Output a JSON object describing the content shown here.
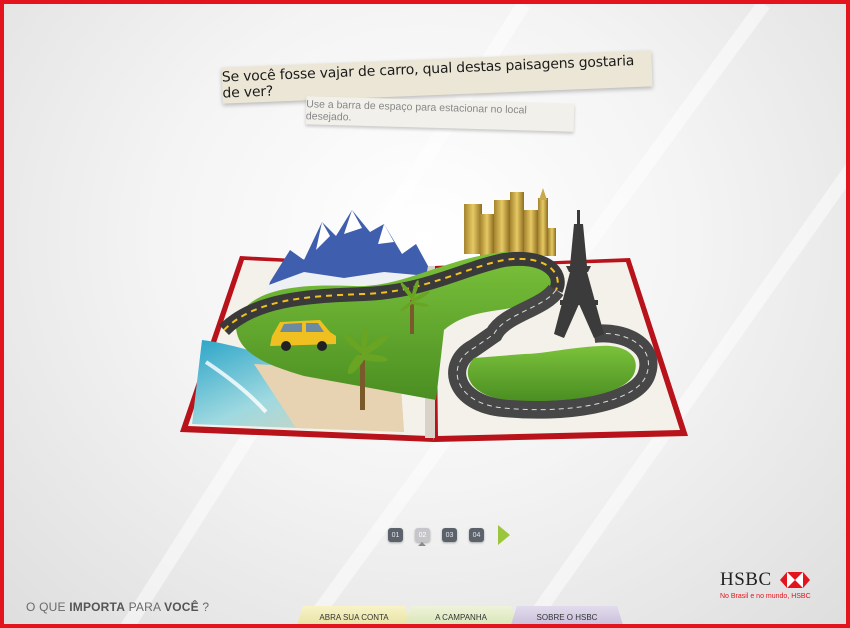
{
  "header": {
    "question": "Se você fosse vajar de carro, qual destas paisagens gostaria de ver?",
    "hint": "Use a barra de espaço para estacionar no local desejado."
  },
  "pager": {
    "pages": [
      "01",
      "02",
      "03",
      "04"
    ],
    "active": "02",
    "next_icon": "next-arrow-icon"
  },
  "footer": {
    "slogan_prefix": "O QUE ",
    "slogan_importa": "IMPORTA",
    "slogan_para": " PARA ",
    "slogan_voce": "VOCÊ",
    "slogan_suffix": " ?",
    "tabs": [
      "ABRA SUA CONTA",
      "A CAMPANHA",
      "SOBRE O HSBC"
    ]
  },
  "brand": {
    "name": "HSBC",
    "tagline": "No Brasil e no mundo, HSBC",
    "accent": "#e3141d"
  },
  "colors": {
    "frame": "#e3141d",
    "next_arrow": "#9bc63c",
    "grass": "#5fa52c",
    "road": "#3d3d3d",
    "book_cover": "#c8141d"
  }
}
